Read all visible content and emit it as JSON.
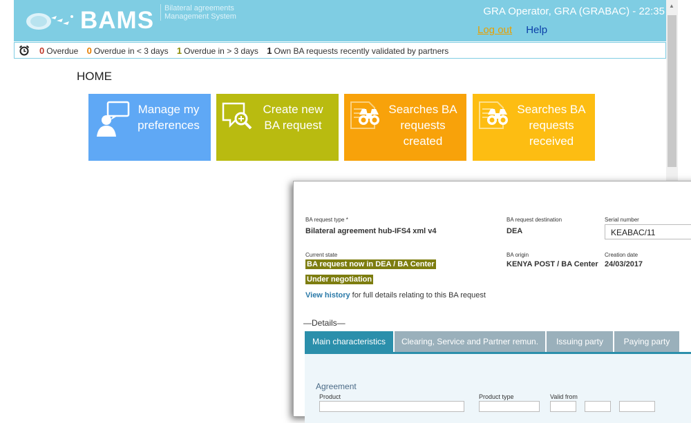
{
  "header": {
    "brand": "BAMS",
    "brand_subtitle": "Bilateral agreements Management System",
    "user": "GRA Operator, GRA (GRABAC) - 22:35",
    "logout": "Log out",
    "help": "Help",
    "bg_color": "#7fcde3"
  },
  "status": {
    "items": [
      {
        "count": "0",
        "label": "Overdue",
        "color": "#c0392b"
      },
      {
        "count": "0",
        "label": "Overdue in < 3 days",
        "color": "#e67e00"
      },
      {
        "count": "1",
        "label": "Overdue in > 3 days",
        "color": "#8a8a00"
      },
      {
        "count": "1",
        "label": "Own BA requests recently validated by partners",
        "color": "#222222"
      }
    ]
  },
  "page": {
    "title": "HOME"
  },
  "tiles": [
    {
      "label": "Manage my preferences",
      "color": "#5fa8f5",
      "icon": "user-chat-icon"
    },
    {
      "label": "Create new BA request",
      "color": "#b9bb10",
      "icon": "search-document-icon"
    },
    {
      "label": "Searches BA requests created",
      "color": "#f8a20a",
      "icon": "binoculars-icon"
    },
    {
      "label": "Searches BA requests received",
      "color": "#fdbd12",
      "icon": "binoculars-icon"
    }
  ],
  "detail": {
    "request_type_label": "BA request type *",
    "request_type_value": "Bilateral agreement hub-IFS4 xml v4",
    "destination_label": "BA request destination",
    "destination_value": "DEA",
    "serial_label": "Serial number",
    "serial_value": "KEABAC/11",
    "state_label": "Current state",
    "state_value": "BA request now in DEA / BA Center",
    "state_sub": "Under negotiation",
    "origin_label": "BA origin",
    "origin_value": "KENYA POST / BA Center",
    "creation_label": "Creation date",
    "creation_value": "24/03/2017",
    "history_link": "View history",
    "history_text": " for full details relating to this BA request",
    "details_legend": "—Details—",
    "tabs": [
      "Main characteristics",
      "Clearing, Service and Partner remun.",
      "Issuing party",
      "Paying party"
    ],
    "agreement_title": "Agreement",
    "product_label": "Product",
    "product_type_label": "Product type",
    "valid_from_label": "Valid from"
  }
}
